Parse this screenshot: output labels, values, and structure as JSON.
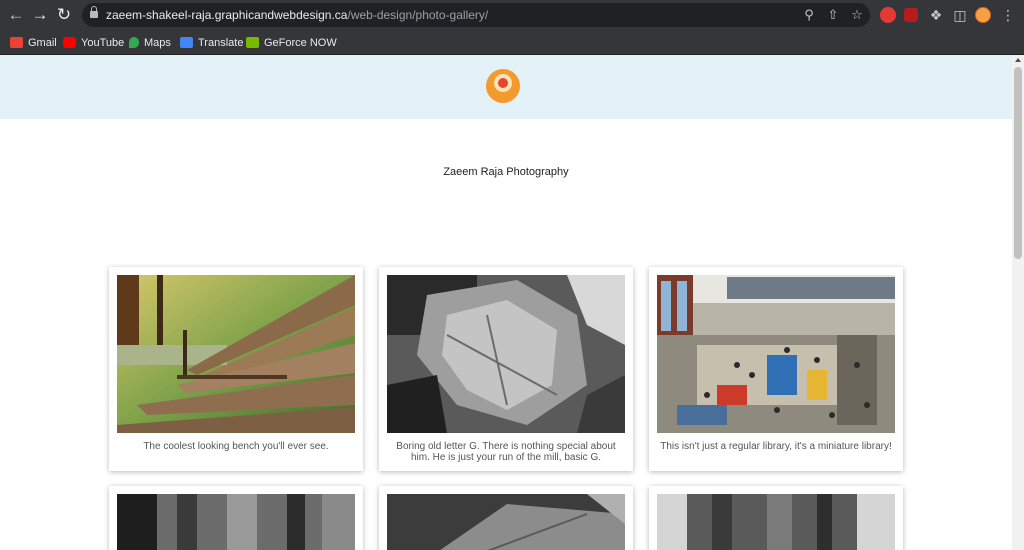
{
  "browser": {
    "url_domain": "zaeem-shakeel-raja.graphicandwebdesign.ca",
    "url_path": "/web-design/photo-gallery/",
    "bookmarks": [
      {
        "label": "Gmail",
        "icon": "gmail-icon",
        "color": "#ea4335"
      },
      {
        "label": "YouTube",
        "icon": "youtube-icon",
        "color": "#ff0000"
      },
      {
        "label": "Maps",
        "icon": "maps-icon",
        "color": "#34a853"
      },
      {
        "label": "Translate",
        "icon": "translate-icon",
        "color": "#4285f4"
      },
      {
        "label": "GeForce NOW",
        "icon": "geforce-now-icon",
        "color": "#76b900"
      }
    ]
  },
  "site": {
    "title": "Zaeem Raja Photography",
    "header_color": "#e3f2f8",
    "logo_color": "#f39a2d"
  },
  "gallery": [
    {
      "caption": "The coolest looking bench you'll ever see.",
      "subject": "bench"
    },
    {
      "caption": "Boring old letter G. There is nothing special about him. He is just your run of the mill, basic G.",
      "subject": "leaf"
    },
    {
      "caption": "This isn't just a regular library, it's a miniature library!",
      "subject": "library"
    },
    {
      "caption": "",
      "subject": "tree-bark"
    },
    {
      "caption": "",
      "subject": "leaf"
    },
    {
      "caption": "",
      "subject": "tree-trunk"
    }
  ]
}
